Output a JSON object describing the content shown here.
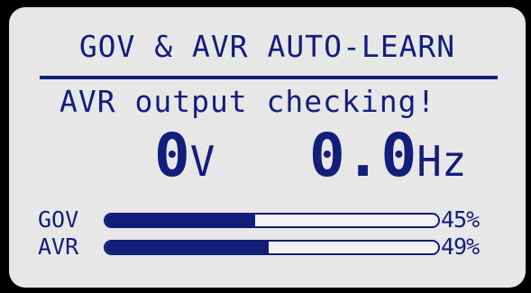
{
  "header": {
    "title": "GOV & AVR AUTO-LEARN"
  },
  "status": {
    "message": "AVR output checking!"
  },
  "readings": {
    "voltage_value": "0",
    "voltage_unit": "V",
    "frequency_value": "0.0",
    "frequency_unit": "Hz"
  },
  "progress": {
    "gov": {
      "label": "GOV",
      "value": 0.45,
      "percent_text": "45%"
    },
    "avr": {
      "label": "AVR",
      "value": 0.49,
      "percent_text": "49%"
    }
  },
  "colors": {
    "screen_background": "#e7e7e7",
    "lcd_text": "#121e7a",
    "bezel": "#000000"
  }
}
